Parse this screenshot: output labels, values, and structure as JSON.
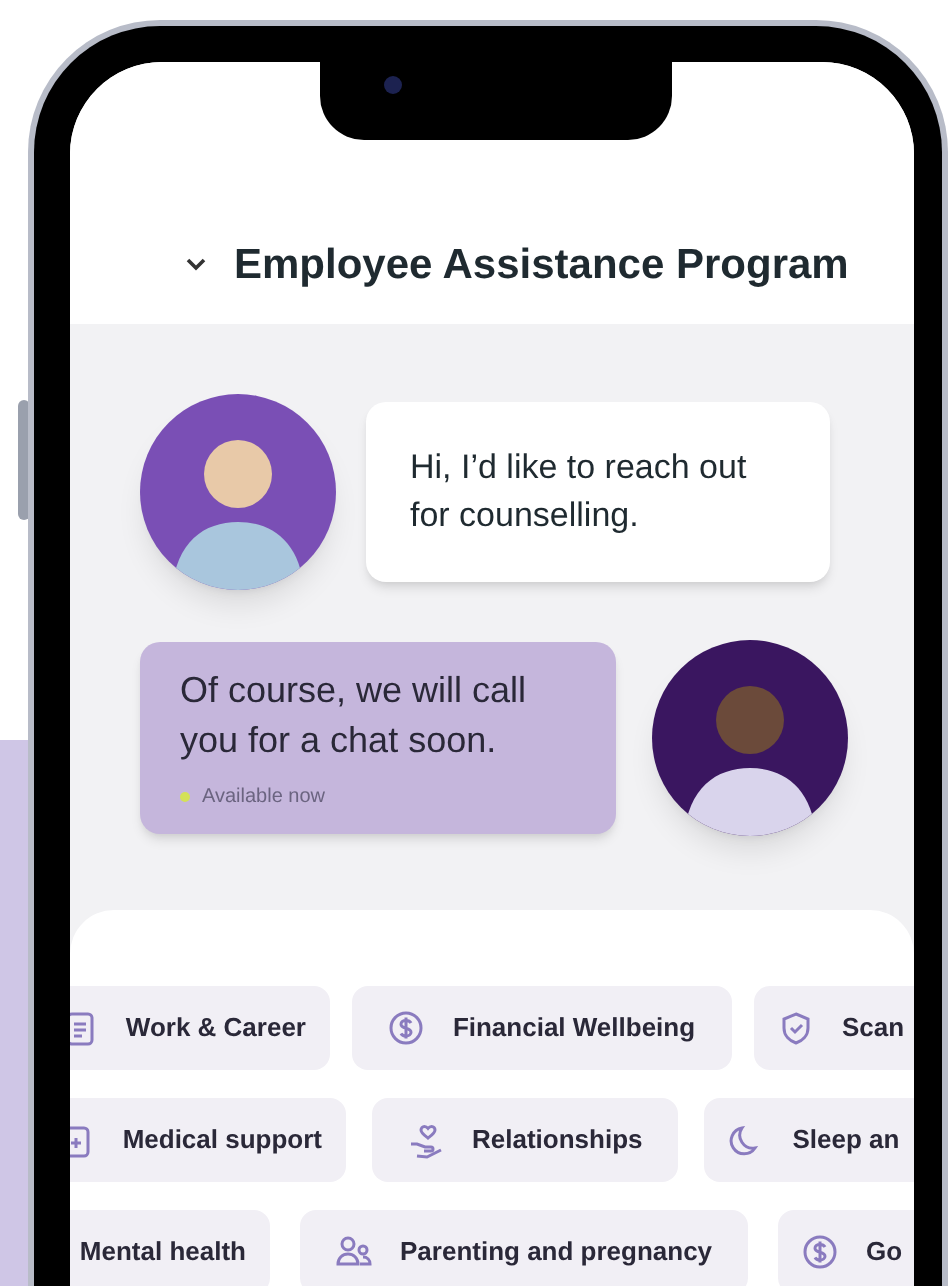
{
  "header": {
    "title": "Employee Assistance Program"
  },
  "messages": [
    {
      "kind": "incoming",
      "text": "Hi, I’d like to reach out for counselling."
    },
    {
      "kind": "outgoing",
      "text": "Of course, we will call you for a chat soon.",
      "status": {
        "text": "Available now",
        "color": "#d4e157"
      }
    }
  ],
  "chip_rows": [
    [
      {
        "kind": "document",
        "label": "Work & Career"
      },
      {
        "kind": "dollar",
        "label": "Financial Wellbeing"
      },
      {
        "kind": "shield",
        "label": "Scan"
      }
    ],
    [
      {
        "kind": "medical",
        "label": "Medical support"
      },
      {
        "kind": "hand-heart",
        "label": "Relationships"
      },
      {
        "kind": "moon",
        "label": "Sleep an"
      }
    ],
    [
      {
        "kind": "plain",
        "label": "Mental health"
      },
      {
        "kind": "people",
        "label": "Parenting and pregnancy"
      },
      {
        "kind": "dollar",
        "label": "Go"
      }
    ]
  ]
}
